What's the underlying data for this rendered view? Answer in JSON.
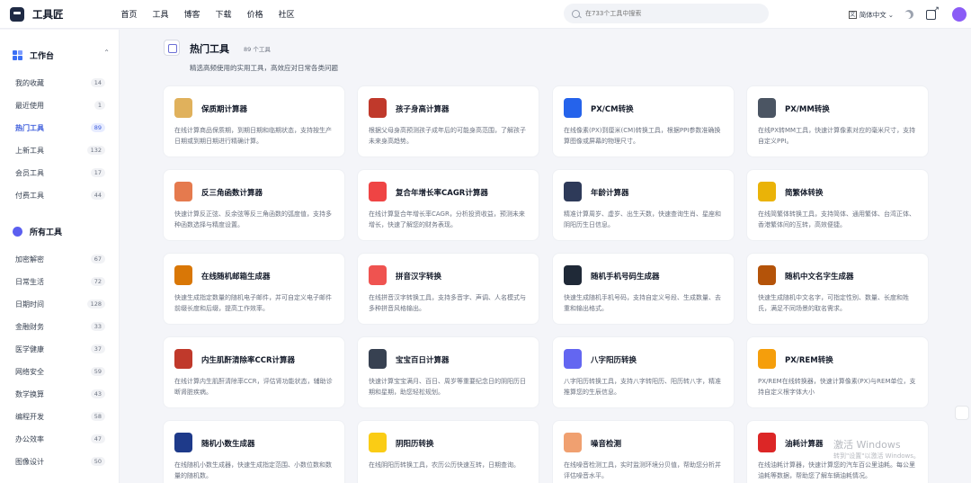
{
  "app": {
    "title": "工具匠"
  },
  "nav": [
    {
      "label": "首页"
    },
    {
      "label": "工具"
    },
    {
      "label": "博客"
    },
    {
      "label": "下载"
    },
    {
      "label": "价格"
    },
    {
      "label": "社区"
    }
  ],
  "search": {
    "placeholder": "在733个工具中搜索"
  },
  "header": {
    "lang_label": "简体中文",
    "lang_chevron": "⌄"
  },
  "sidebar": {
    "workspace": {
      "title": "工作台",
      "items": [
        {
          "label": "我的收藏",
          "count": "14"
        },
        {
          "label": "最近使用",
          "count": "1"
        },
        {
          "label": "热门工具",
          "count": "89"
        },
        {
          "label": "上新工具",
          "count": "132"
        },
        {
          "label": "会员工具",
          "count": "17"
        },
        {
          "label": "付费工具",
          "count": "44"
        }
      ]
    },
    "all_tools": {
      "title": "所有工具",
      "items": [
        {
          "label": "加密解密",
          "count": "67"
        },
        {
          "label": "日常生活",
          "count": "72"
        },
        {
          "label": "日期时间",
          "count": "128"
        },
        {
          "label": "金融财务",
          "count": "33"
        },
        {
          "label": "医学健康",
          "count": "37"
        },
        {
          "label": "网络安全",
          "count": "59"
        },
        {
          "label": "数学换算",
          "count": "43"
        },
        {
          "label": "编程开发",
          "count": "58"
        },
        {
          "label": "办公效率",
          "count": "47"
        },
        {
          "label": "图像设计",
          "count": "50"
        }
      ]
    }
  },
  "main": {
    "title": "热门工具",
    "count": "89 个工具",
    "description": "精选高频使用的实用工具，高效应对日常各类问题"
  },
  "cards": [
    {
      "title": "保质期计算器",
      "desc": "在线计算商品保质期，到期日期和临期状态，支持按生产日期或到期日期进行精确计算。",
      "icon": "calendar-icon",
      "color": "#e0b15c"
    },
    {
      "title": "孩子身高计算器",
      "desc": "根据父母身高预测孩子成年后的可能身高范围，了解孩子未来身高趋势。",
      "icon": "child-height-icon",
      "color": "#c0392b"
    },
    {
      "title": "PX/CM转换",
      "desc": "在线像素(PX)到厘米(CM)转换工具，根据PPI参数准确换算图像或屏幕的物理尺寸。",
      "icon": "ruler-icon",
      "color": "#2563eb"
    },
    {
      "title": "PX/MM转换",
      "desc": "在线PX转MM工具，快速计算像素对应的毫米尺寸，支持自定义PPI。",
      "icon": "ruler-mm-icon",
      "color": "#4b5563"
    },
    {
      "title": "反三角函数计算器",
      "desc": "快速计算反正弦、反余弦等反三角函数的弧度值，支持多种函数选择与精度设置。",
      "icon": "triangle-icon",
      "color": "#e57a4e"
    },
    {
      "title": "复合年增长率CAGR计算器",
      "desc": "在线计算复合年增长率CAGR，分析投资收益，预测未来增长，快速了解您的财务表现。",
      "icon": "growth-chart-icon",
      "color": "#ef4444"
    },
    {
      "title": "年龄计算器",
      "desc": "精准计算周岁、虚岁、出生天数，快速查询生肖、星座和阴阳历生日信息。",
      "icon": "age-icon",
      "color": "#2e3a59"
    },
    {
      "title": "简繁体转换",
      "desc": "在线简繁体转换工具，支持简体、通用繁体、台湾正体、香港繁体间的互转，高效便捷。",
      "icon": "fan-char-icon",
      "color": "#eab308"
    },
    {
      "title": "在线随机邮箱生成器",
      "desc": "快速生成指定数量的随机电子邮件，并可自定义电子邮件前缀长度和后缀，提高工作效率。",
      "icon": "envelope-icon",
      "color": "#d97706"
    },
    {
      "title": "拼音汉字转换",
      "desc": "在线拼音汉字转换工具，支持多音字、声调、人名模式与多种拼音风格输出。",
      "icon": "pinyin-icon",
      "color": "#ef5350"
    },
    {
      "title": "随机手机号码生成器",
      "desc": "快速生成随机手机号码，支持自定义号段、生成数量、去重和输出格式。",
      "icon": "phone-icon",
      "color": "#1f2937"
    },
    {
      "title": "随机中文名字生成器",
      "desc": "快速生成随机中文名字，可指定性别、数量、长度和姓氏，满足不同场景的取名需求。",
      "icon": "name-tag-icon",
      "color": "#b45309"
    },
    {
      "title": "内生肌酐清除率CCR计算器",
      "desc": "在线计算内生肌酐清除率CCR，评估肾功能状态，辅助诊断肾脏疾病。",
      "icon": "kidney-icon",
      "color": "#c0392b"
    },
    {
      "title": "宝宝百日计算器",
      "desc": "快速计算宝宝满月、百日、周岁等重要纪念日的阴阳历日期和星期，助您轻松规划。",
      "icon": "baby-calendar-icon",
      "color": "#374151"
    },
    {
      "title": "八字阳历转换",
      "desc": "八字阳历转换工具，支持八字转阳历、阳历转八字，精准推算您的生辰信息。",
      "icon": "bagua-icon",
      "color": "#6366f1"
    },
    {
      "title": "PX/REM转换",
      "desc": "PX/REM在线转换器，快速计算像素(PX)与REM单位，支持自定义根字体大小",
      "icon": "rem-icon",
      "color": "#f59e0b"
    },
    {
      "title": "随机小数生成器",
      "desc": "在线随机小数生成器，快速生成指定范围、小数位数和数量的随机数。",
      "icon": "decimal-icon",
      "color": "#1e3a8a"
    },
    {
      "title": "阴阳历转换",
      "desc": "在线阴阳历转换工具，农历公历快速互转，日期查询。",
      "icon": "moon-sun-icon",
      "color": "#facc15"
    },
    {
      "title": "噪音检测",
      "desc": "在线噪音检测工具，实时监测环境分贝值，帮助您分析并评估噪音水平。",
      "icon": "ear-icon",
      "color": "#f0a070"
    },
    {
      "title": "油耗计算器",
      "desc": "在线油耗计算器，快速计算您的汽车百公里油耗。每公里油耗等数据，帮助您了解车辆油耗情况。",
      "icon": "car-icon",
      "color": "#dc2626"
    }
  ],
  "watermark": {
    "title": "激活 Windows",
    "sub": "转到\"设置\"以激活 Windows。"
  }
}
